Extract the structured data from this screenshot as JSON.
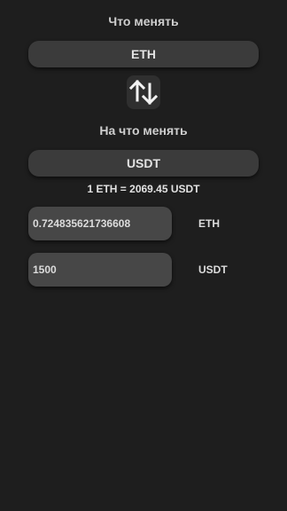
{
  "from": {
    "label": "Что менять",
    "selected": "ETH"
  },
  "to": {
    "label": "На что менять",
    "selected": "USDT"
  },
  "swap_icon": "swap-vertical-arrows-icon",
  "rate_text": "1 ETH = 2069.45 USDT",
  "inputs": {
    "from_amount": "0.724835621736608",
    "from_currency": "ETH",
    "to_amount": "1500",
    "to_currency": "USDT"
  }
}
